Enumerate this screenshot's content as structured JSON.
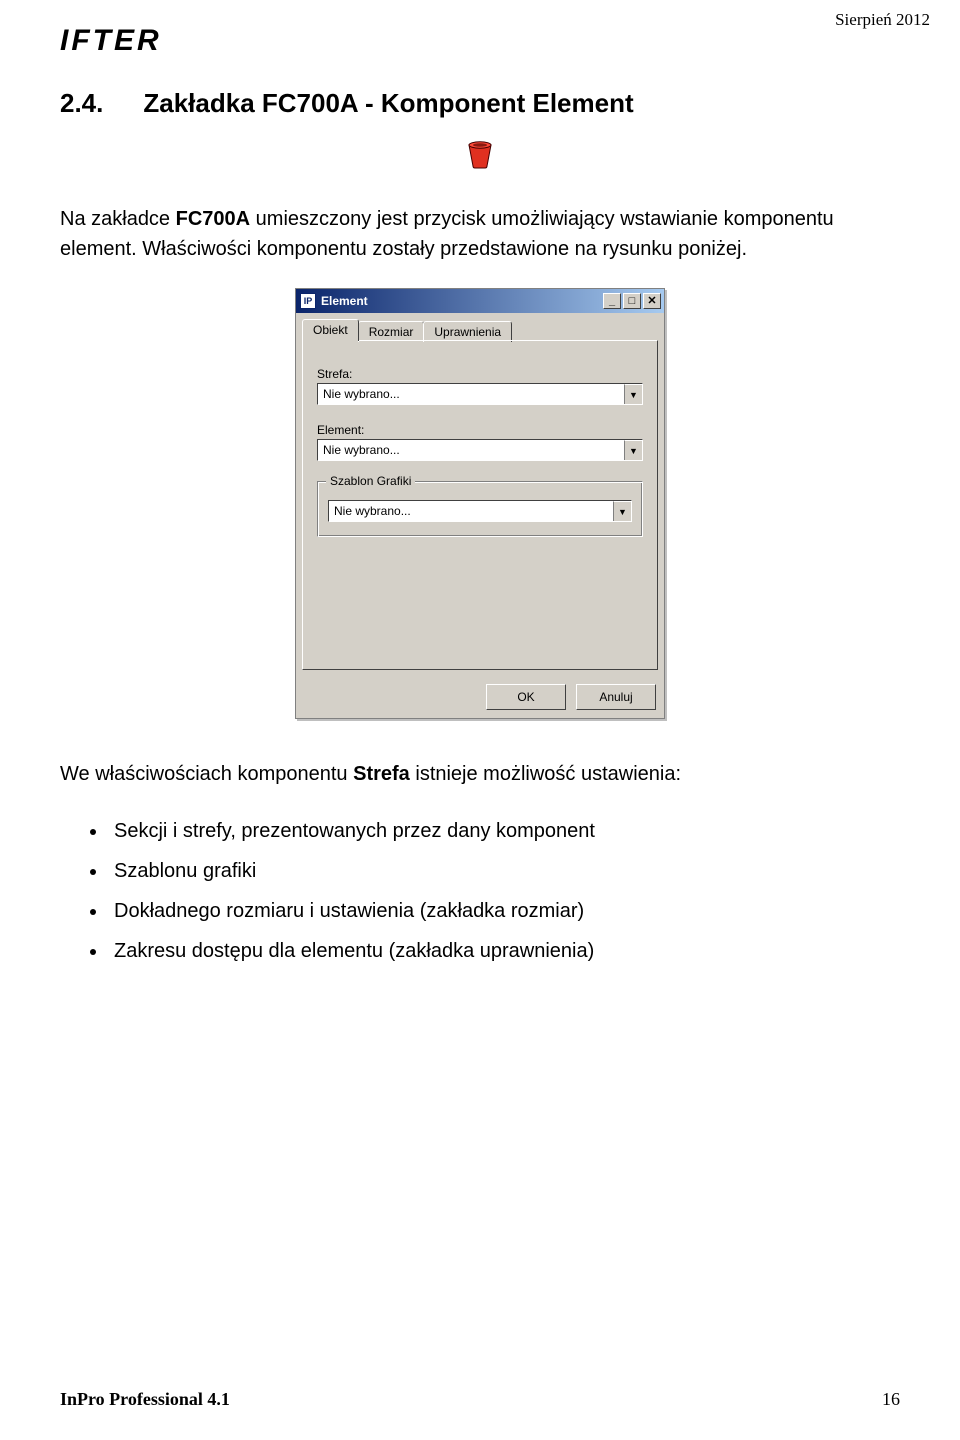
{
  "header": {
    "logo": "IFTER",
    "date": "Sierpień 2012"
  },
  "section": {
    "number": "2.4.",
    "title": "Zakładka  FC700A  - Komponent Element"
  },
  "intro": {
    "text1_a": "Na zakładce ",
    "text1_b": "FC700A",
    "text1_c": " umieszczony jest przycisk umożliwiający wstawianie komponentu element. Właściwości komponentu zostały przedstawione na rysunku poniżej."
  },
  "dialog": {
    "title": "Element",
    "app_icon_text": "IP",
    "tabs": [
      "Obiekt",
      "Rozmiar",
      "Uprawnienia"
    ],
    "fields": {
      "strefa_label": "Strefa:",
      "strefa_value": "Nie wybrano...",
      "element_label": "Element:",
      "element_value": "Nie wybrano...",
      "group_label": "Szablon Grafiki",
      "group_value": "Nie wybrano..."
    },
    "buttons": {
      "ok": "OK",
      "cancel": "Anuluj"
    },
    "win": {
      "min": "_",
      "max": "□",
      "close": "✕"
    }
  },
  "after": {
    "text_a": "We właściwościach komponentu ",
    "text_b": "Strefa",
    "text_c": "  istnieje możliwość ustawienia:"
  },
  "bullets": [
    "Sekcji i strefy, prezentowanych przez dany komponent",
    "Szablonu grafiki",
    "Dokładnego rozmiaru i ustawienia (zakładka rozmiar)",
    "Zakresu dostępu dla elementu (zakładka uprawnienia)"
  ],
  "footer": {
    "product": "InPro Professional 4.1",
    "page": "16"
  }
}
